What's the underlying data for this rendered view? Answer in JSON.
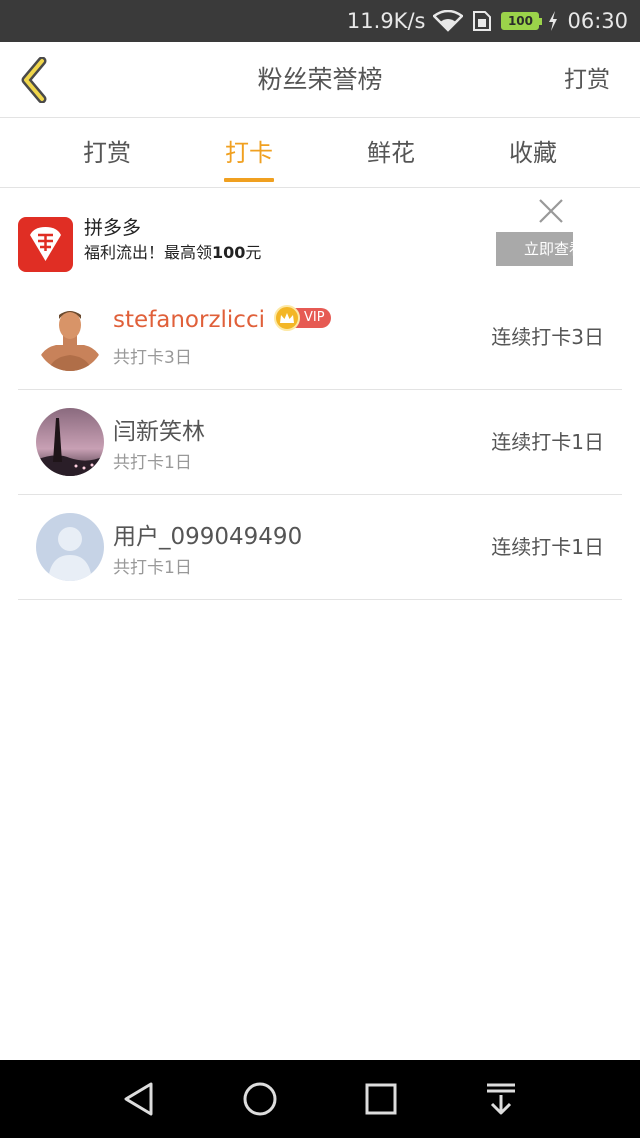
{
  "status_bar": {
    "net_speed": "11.9K/s",
    "battery": "100",
    "time": "06:30",
    "icons": [
      "wifi-icon",
      "sim-icon",
      "battery-icon",
      "charging-icon"
    ]
  },
  "header": {
    "title": "粉丝荣誉榜",
    "action": "打赏",
    "back_icon": "chevron-left-icon"
  },
  "tabs": [
    {
      "label": "打赏",
      "active": false
    },
    {
      "label": "打卡",
      "active": true
    },
    {
      "label": "鲜花",
      "active": false
    },
    {
      "label": "收藏",
      "active": false
    }
  ],
  "ad": {
    "title": "拼多多",
    "desc_prefix": "福利流出！最高领",
    "desc_amount": "100",
    "desc_suffix": "元",
    "cta": "立即查看",
    "close_icon": "close-icon"
  },
  "list": [
    {
      "name": "stefanorzlicci",
      "vip": true,
      "vip_label": "VIP",
      "total": "共打卡3日",
      "streak": "连续打卡3日"
    },
    {
      "name": "闫新笑林",
      "vip": false,
      "total": "共打卡1日",
      "streak": "连续打卡1日"
    },
    {
      "name": "用户_099049490",
      "vip": false,
      "total": "共打卡1日",
      "streak": "连续打卡1日"
    }
  ],
  "nav_bar": {
    "buttons": [
      "back-triangle-icon",
      "home-circle-icon",
      "recents-square-icon",
      "notification-pull-icon"
    ]
  },
  "colors": {
    "accent": "#f0a020",
    "vip_name": "#e0603a",
    "status_bar": "#3a3a3a",
    "ad_logo": "#e02e24"
  }
}
